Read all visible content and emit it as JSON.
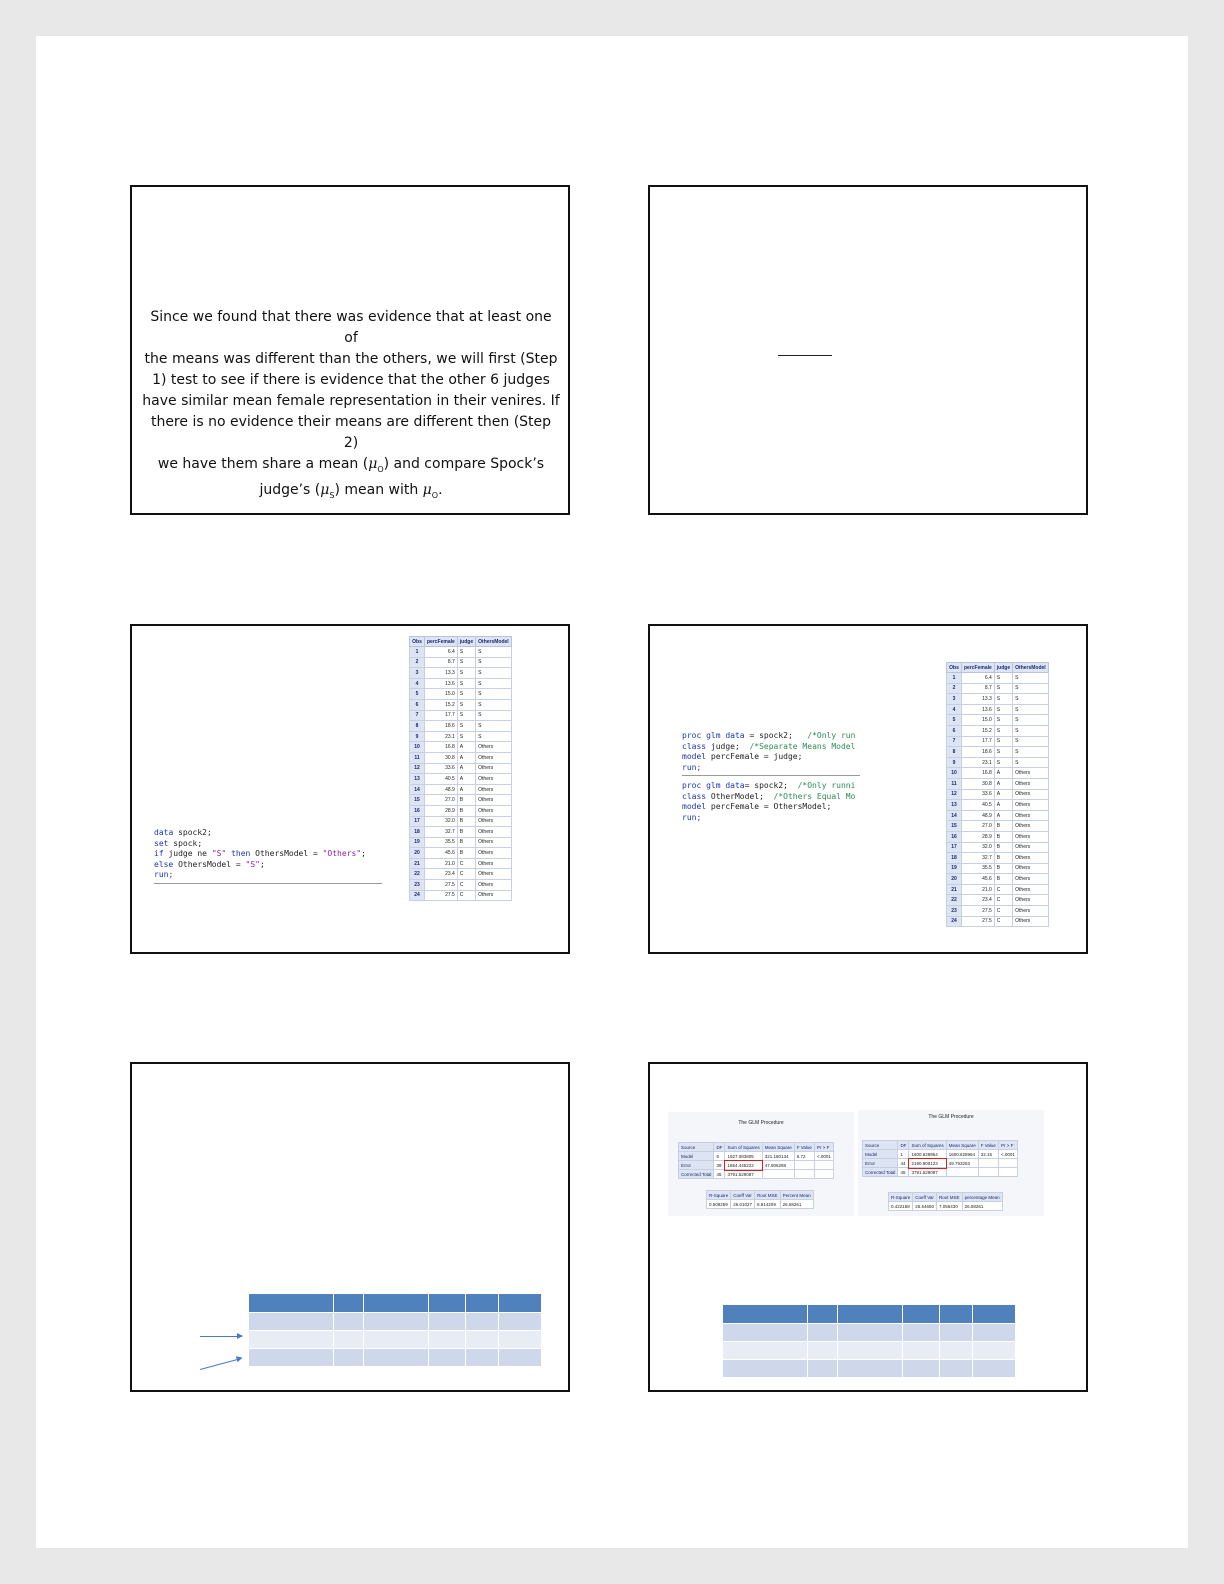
{
  "slide1": {
    "lines": [
      "Since we found that there was evidence that at least one of",
      "the means was different than the others, we will first (Step",
      "1) test to see if there is evidence that the other 6 judges",
      "have similar mean female representation in their venires.  If",
      "there is no evidence their means are different then (Step 2)"
    ],
    "line6a": "we have them share a mean (",
    "mu0": "μ",
    "sub0": "O",
    "line6b": ") and compare Spock’s",
    "line7a": "judge’s (",
    "muS": "μ",
    "subS": "S",
    "line7b": ") mean with ",
    "mu0b": "μ",
    "sub0b": "O",
    "line7c": "."
  },
  "code_data": {
    "l1a": "data",
    "l1b": " spock2;",
    "l2a": "set",
    "l2b": " spock;",
    "l3a": "if",
    "l3b": " judge ne ",
    "l3c": "\"S\"",
    "l3d": " then",
    "l3e": " OthersModel = ",
    "l3f": "\"Others\"",
    "l3g": ";",
    "l4a": "else",
    "l4b": " OthersModel = ",
    "l4c": "\"S\"",
    "l4d": ";",
    "l5": "run;"
  },
  "code_glm": {
    "a1a": "proc glm",
    "a1b": " data",
    "a1c": " = spock2;   ",
    "a1d": "/*Only run",
    "a2a": "class",
    "a2b": " judge;  ",
    "a2c": "/*Separate Means Model",
    "a3a": "model",
    "a3b": " percFemale = judge;",
    "a4": "run;",
    "b1a": "proc glm",
    "b1b": " data",
    "b1c": "= spock2;  ",
    "b1d": "/*Only runni",
    "b2a": "class",
    "b2b": " OtherModel;  ",
    "b2c": "/*Others Equal Mo",
    "b3a": "model",
    "b3b": " percFemale = OthersModel;",
    "b4": "run;"
  },
  "obs_table": {
    "headers": [
      "Obs",
      "percFemale",
      "judge",
      "OthersModel"
    ],
    "rows": [
      [
        "1",
        "6.4",
        "S",
        "S"
      ],
      [
        "2",
        "8.7",
        "S",
        "S"
      ],
      [
        "3",
        "13.3",
        "S",
        "S"
      ],
      [
        "4",
        "13.6",
        "S",
        "S"
      ],
      [
        "5",
        "15.0",
        "S",
        "S"
      ],
      [
        "6",
        "15.2",
        "S",
        "S"
      ],
      [
        "7",
        "17.7",
        "S",
        "S"
      ],
      [
        "8",
        "18.6",
        "S",
        "S"
      ],
      [
        "9",
        "23.1",
        "S",
        "S"
      ],
      [
        "10",
        "16.8",
        "A",
        "Others"
      ],
      [
        "11",
        "30.8",
        "A",
        "Others"
      ],
      [
        "12",
        "33.6",
        "A",
        "Others"
      ],
      [
        "13",
        "40.5",
        "A",
        "Others"
      ],
      [
        "14",
        "48.9",
        "A",
        "Others"
      ],
      [
        "15",
        "27.0",
        "B",
        "Others"
      ],
      [
        "16",
        "28.9",
        "B",
        "Others"
      ],
      [
        "17",
        "32.0",
        "B",
        "Others"
      ],
      [
        "18",
        "32.7",
        "B",
        "Others"
      ],
      [
        "19",
        "35.5",
        "B",
        "Others"
      ],
      [
        "20",
        "45.6",
        "B",
        "Others"
      ],
      [
        "21",
        "21.0",
        "C",
        "Others"
      ],
      [
        "22",
        "23.4",
        "C",
        "Others"
      ],
      [
        "23",
        "27.5",
        "C",
        "Others"
      ],
      [
        "24",
        "27.5",
        "C",
        "Others"
      ]
    ]
  },
  "glm_left": {
    "title": "The GLM Procedure",
    "anova_headers": [
      "Source",
      "DF",
      "Sum of Squares",
      "Mean Square",
      "F Value",
      "Pr > F"
    ],
    "anova_rows": [
      [
        "Model",
        "6",
        "1927.083805",
        "321.180134",
        "6.72",
        "<.0001"
      ],
      [
        "Error",
        "39",
        "1864.445222",
        "47.806288",
        "",
        ""
      ],
      [
        "Corrected Total",
        "45",
        "3791.529087",
        "",
        "",
        ""
      ]
    ],
    "fit_headers": [
      "R-Square",
      "Coeff Var",
      "Root MSE",
      "Percent Mean"
    ],
    "fit_row": [
      "0.508259",
      "26.01027",
      "6.914209",
      "26.58261"
    ]
  },
  "glm_right": {
    "title": "The GLM Procedure",
    "anova_headers": [
      "Source",
      "DF",
      "Sum of Squares",
      "Mean Square",
      "F Value",
      "Pr > F"
    ],
    "anova_rows": [
      [
        "Model",
        "1",
        "1600.628964",
        "1600.628964",
        "32.15",
        "<.0001"
      ],
      [
        "Error",
        "44",
        "2190.900123",
        "49.793253",
        "",
        ""
      ],
      [
        "Corrected Total",
        "45",
        "3791.529087",
        "",
        "",
        ""
      ]
    ],
    "fit_headers": [
      "R-Square",
      "Coeff Var",
      "Root MSE",
      "percentage Mean"
    ],
    "fit_row": [
      "0.422158",
      "26.54650",
      "7.056430",
      "26.58261"
    ]
  }
}
